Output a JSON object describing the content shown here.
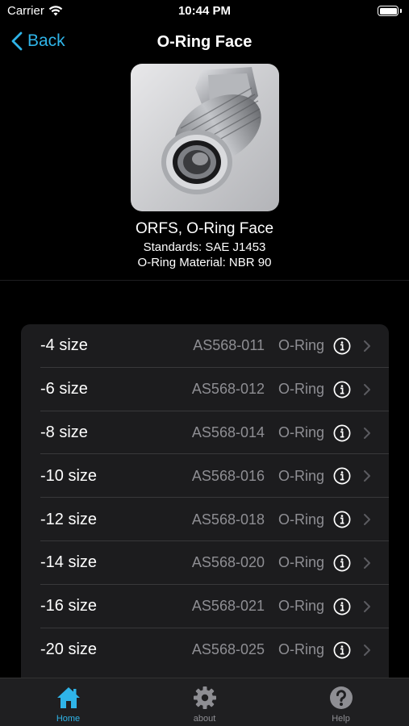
{
  "status": {
    "carrier": "Carrier",
    "time": "10:44 PM"
  },
  "nav": {
    "back_label": "Back",
    "title": "O-Ring Face"
  },
  "fitting": {
    "name": "ORFS, O-Ring Face",
    "standards": "Standards: SAE J1453",
    "material": "O-Ring Material: NBR 90"
  },
  "sizes": [
    {
      "label": "-4 size",
      "part": "AS568-011",
      "type": "O-Ring"
    },
    {
      "label": "-6 size",
      "part": "AS568-012",
      "type": "O-Ring"
    },
    {
      "label": "-8 size",
      "part": "AS568-014",
      "type": "O-Ring"
    },
    {
      "label": "-10 size",
      "part": "AS568-016",
      "type": "O-Ring"
    },
    {
      "label": "-12 size",
      "part": "AS568-018",
      "type": "O-Ring"
    },
    {
      "label": "-14 size",
      "part": "AS568-020",
      "type": "O-Ring"
    },
    {
      "label": "-16 size",
      "part": "AS568-021",
      "type": "O-Ring"
    },
    {
      "label": "-20 size",
      "part": "AS568-025",
      "type": "O-Ring"
    }
  ],
  "tabs": [
    {
      "label": "Home",
      "icon": "home-icon",
      "active": true
    },
    {
      "label": "about",
      "icon": "gear-icon",
      "active": false
    },
    {
      "label": "Help",
      "icon": "help-icon",
      "active": false
    }
  ],
  "colors": {
    "accent": "#2fb4e8",
    "background": "#000000",
    "cell": "#1c1c1e",
    "secondary_text": "#8e8e93"
  }
}
